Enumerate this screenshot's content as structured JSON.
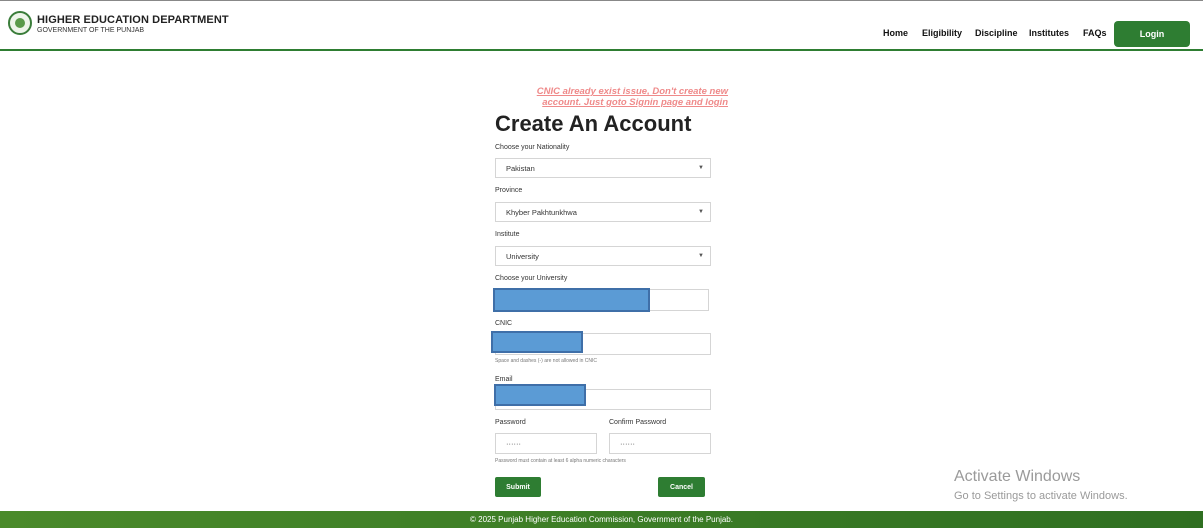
{
  "header": {
    "title": "HIGHER EDUCATION DEPARTMENT",
    "subtitle": "GOVERNMENT OF THE PUNJAB",
    "nav": [
      "Home",
      "Eligibility",
      "Discipline",
      "Institutes",
      "FAQs"
    ],
    "login_label": "Login"
  },
  "notice": {
    "line1": "CNIC already exist issue, Don't create new",
    "line2": "account. Just goto Signin page and login"
  },
  "form": {
    "title": "Create An Account",
    "nationality_label": "Choose your Nationality",
    "nationality_value": "Pakistan",
    "province_label": "Province",
    "province_value": "Khyber Pakhtunkhwa",
    "institute_label": "Institute",
    "institute_value": "University",
    "university_label": "Choose your University",
    "cnic_label": "CNIC",
    "cnic_hint": "Space and dashes (-) are not allowed in CNIC",
    "email_label": "Email",
    "password_label": "Password",
    "password_value": "······",
    "confirm_label": "Confirm Password",
    "confirm_value": "······",
    "password_hint": "Password must contain at least 6 alpha numeric characters",
    "submit_label": "Submit",
    "cancel_label": "Cancel"
  },
  "footer": {
    "text": "© 2025 Punjab Higher Education Commission, Government of the Punjab."
  },
  "watermark": {
    "line1": "Activate Windows",
    "line2": "Go to Settings to activate Windows."
  },
  "colors": {
    "brand_green": "#2e7d32",
    "notice_red": "#ef8a8a",
    "redaction_blue": "#5b9bd5"
  }
}
